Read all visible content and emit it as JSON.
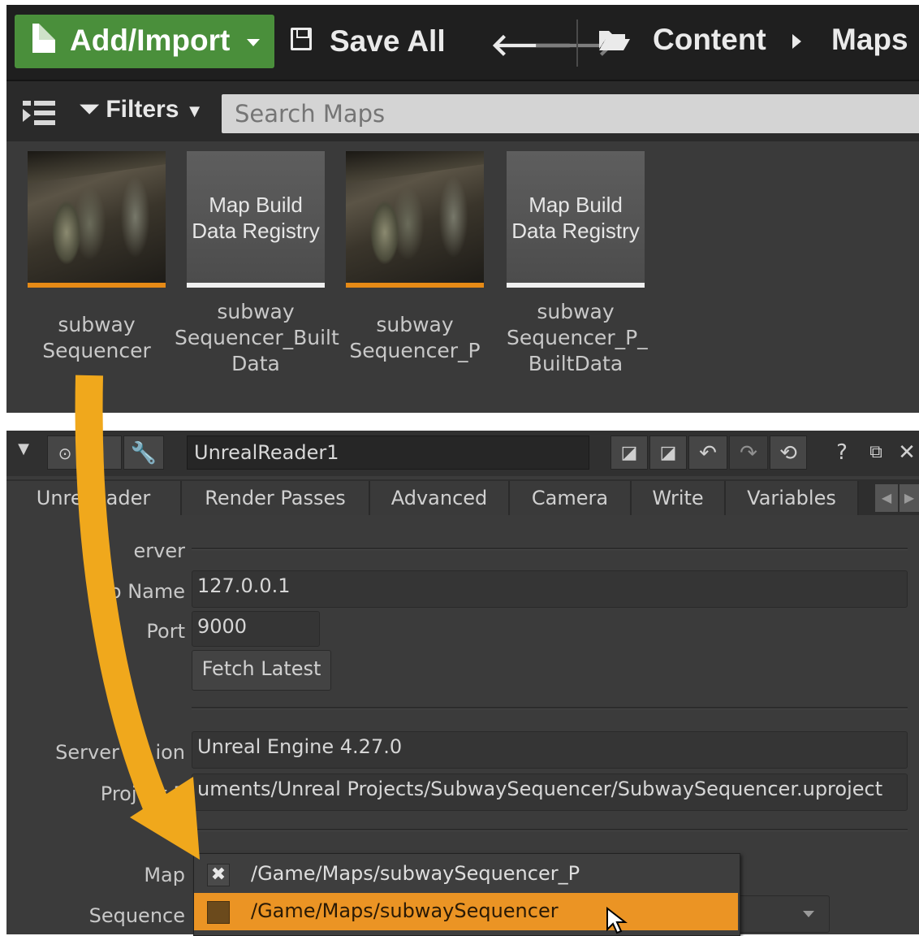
{
  "content_browser": {
    "add_import_label": "Add/Import",
    "save_all_label": "Save All",
    "breadcrumb": [
      "Content",
      "Maps"
    ],
    "filters_label": "Filters",
    "search_placeholder": "Search Maps",
    "assets": [
      {
        "name": "subway\nSequencer",
        "thumb": "image"
      },
      {
        "name": "subway\nSequencer_Built\nData",
        "thumb": "registry",
        "thumb_text": "Map Build\nData Registry"
      },
      {
        "name": "subway\nSequencer_P",
        "thumb": "image"
      },
      {
        "name": "subway\nSequencer_P_\nBuiltData",
        "thumb": "registry",
        "thumb_text": "Map Build\nData Registry"
      }
    ]
  },
  "properties": {
    "node_name": "UnrealReader1",
    "tabs": [
      "Unreal ader",
      "Render Passes",
      "Advanced",
      "Camera",
      "Write",
      "Variables"
    ],
    "server_section": "erver",
    "host_label": "Ho  Name",
    "host_value": "127.0.0.1",
    "port_label": "Port",
    "port_value": "9000",
    "fetch_label": "Fetch Latest",
    "server_version_label": "Server Ve  ion",
    "server_version_value": "Unreal Engine 4.27.0",
    "project_label": "Project P",
    "project_value": "uments/Unreal Projects/SubwaySequencer/SubwaySequencer.uproject",
    "map_label": "Map",
    "sequence_label": "Sequence",
    "map_options": [
      {
        "label": "/Game/Maps/subwaySequencer_P",
        "checked": true
      },
      {
        "label": "/Game/Maps/subwaySequencer",
        "checked": false,
        "highlighted": true
      }
    ]
  },
  "colors": {
    "accent_green": "#4a8f3b",
    "highlight_orange": "#eb9424",
    "arrow_yellow": "#f0a81c"
  }
}
